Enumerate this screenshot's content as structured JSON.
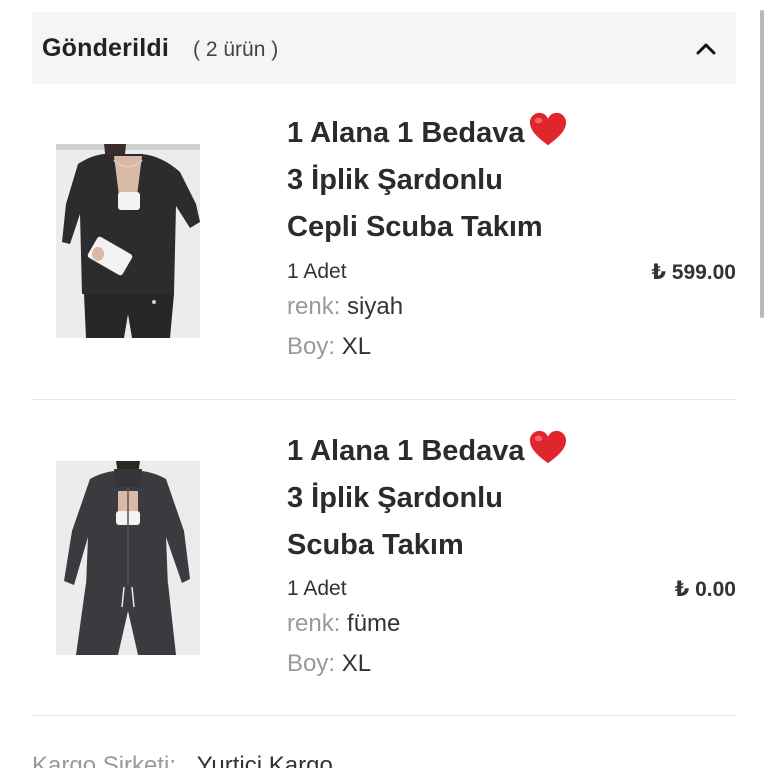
{
  "section": {
    "title": "Gönderildi",
    "count": "( 2 ürün )",
    "toggle_icon": "chevron-up-icon"
  },
  "items": [
    {
      "title_line1": "1 Alana 1 Bedava",
      "title_line2": "3 İplik Şardonlu",
      "title_line3": "Cepli Scuba Takım",
      "title_icon": "red-heart-emoji",
      "quantity": "1 Adet",
      "price": "₺ 599.00",
      "color_label": "renk:",
      "color_value": "siyah",
      "size_label": "Boy:",
      "size_value": "XL"
    },
    {
      "title_line1": "1 Alana 1 Bedava",
      "title_line2": "3 İplik Şardonlu",
      "title_line3": "Scuba Takım",
      "title_icon": "red-heart-emoji",
      "quantity": "1 Adet",
      "price": "₺ 0.00",
      "color_label": "renk:",
      "color_value": "füme",
      "size_label": "Boy:",
      "size_value": "XL"
    }
  ],
  "shipping": {
    "label": "Kargo Şirketi:",
    "value": "Yurtiçi Kargo"
  },
  "colors": {
    "header_bg": "#f5f5f5",
    "heart": "#e0262d",
    "muted_text": "#9a9a9a"
  }
}
